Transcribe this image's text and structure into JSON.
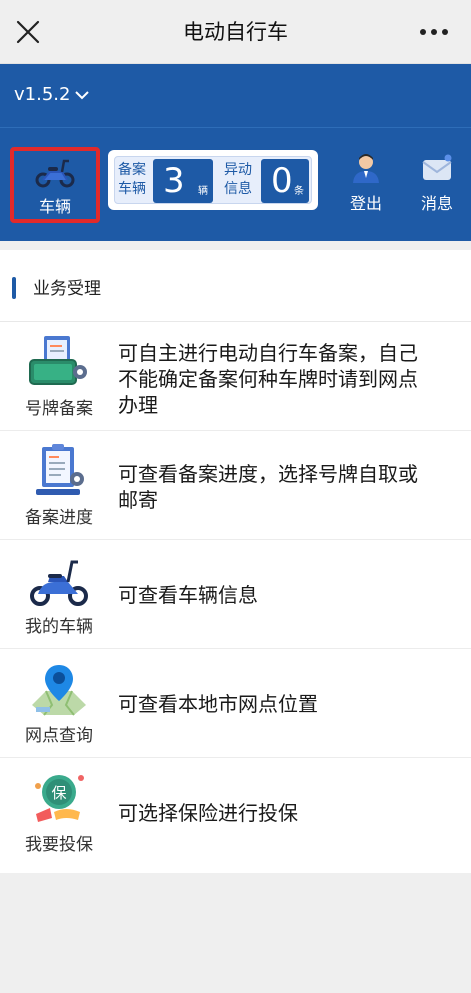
{
  "nav": {
    "title": "电动自行车",
    "close_icon": "close-icon",
    "more_icon": "more-dots-icon"
  },
  "header": {
    "version": "v1.5.2",
    "vehicle_tile": {
      "label": "车辆",
      "icon": "scooter-icon"
    },
    "stats": {
      "registered_label_1": "备案",
      "registered_label_2": "车辆",
      "registered_count": "3",
      "registered_unit": "辆",
      "abnormal_label_1": "异动",
      "abnormal_label_2": "信息",
      "abnormal_count": "0",
      "abnormal_unit": "条"
    },
    "logout": {
      "label": "登出",
      "icon": "user-icon"
    },
    "messages": {
      "label": "消息",
      "icon": "envelope-icon"
    }
  },
  "section": {
    "title": "业务受理"
  },
  "services": [
    {
      "label": "号牌备案",
      "icon": "license-plate-icon",
      "description": "可自主进行电动自行车备案，自己不能确定备案何种车牌时请到网点办理"
    },
    {
      "label": "备案进度",
      "icon": "clipboard-progress-icon",
      "description": "可查看备案进度，选择号牌自取或邮寄"
    },
    {
      "label": "我的车辆",
      "icon": "scooter-icon",
      "description": "可查看车辆信息"
    },
    {
      "label": "网点查询",
      "icon": "map-pin-icon",
      "description": "可查看本地市网点位置"
    },
    {
      "label": "我要投保",
      "icon": "insurance-shield-icon",
      "description": "可选择保险进行投保"
    }
  ],
  "colors": {
    "primary": "#1e5aa6",
    "highlight": "#e22a2a"
  }
}
